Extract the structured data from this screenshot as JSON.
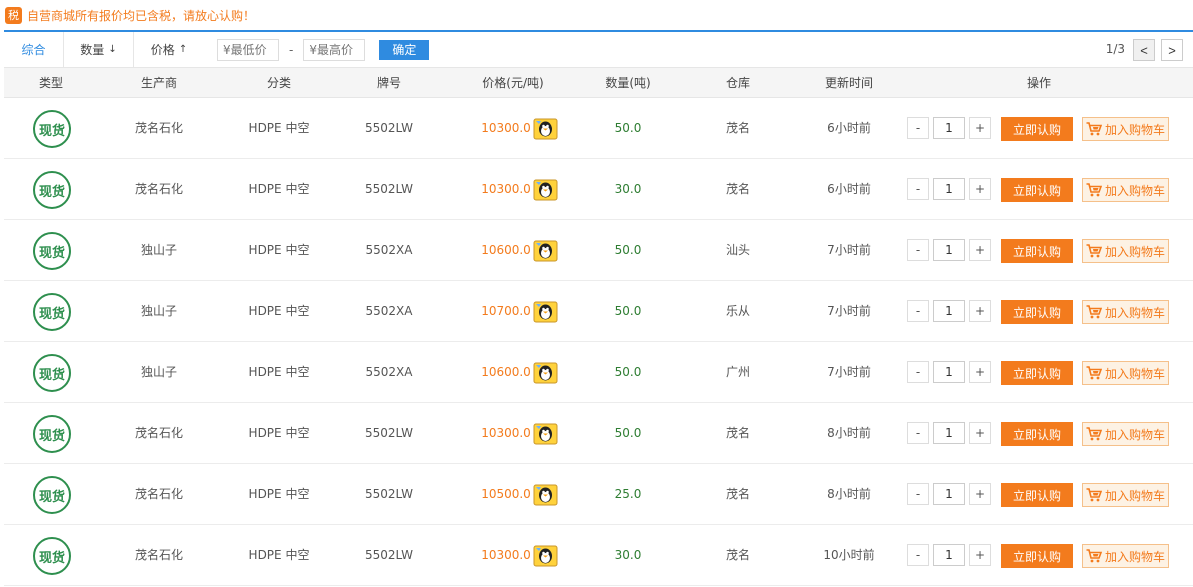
{
  "notice": {
    "badge": "税",
    "text": "自营商城所有报价均已含税，请放心认购！"
  },
  "toolbar": {
    "tabs": [
      {
        "label": "综合",
        "arrow": ""
      },
      {
        "label": "数量",
        "arrow": "↓"
      },
      {
        "label": "价格",
        "arrow": "↑"
      }
    ],
    "min_price_placeholder": "¥最低价",
    "max_price_placeholder": "¥最高价",
    "dash": "-",
    "confirm_label": "确定",
    "pager": "1/3",
    "prev": "<",
    "next": ">"
  },
  "table": {
    "headers": [
      "类型",
      "生产商",
      "分类",
      "牌号",
      "价格(元/吨)",
      "数量(吨)",
      "仓库",
      "更新时间",
      "操作"
    ],
    "stamp_text": "现货",
    "buy_label": "立即认购",
    "cart_label": "加入购物车",
    "minus": "-",
    "plus": "+",
    "rows": [
      {
        "maker": "茂名石化",
        "category": "HDPE 中空",
        "grade": "5502LW",
        "price": "10300.0",
        "qty": "50.0",
        "warehouse": "茂名",
        "updated": "6小时前",
        "count": "1"
      },
      {
        "maker": "茂名石化",
        "category": "HDPE 中空",
        "grade": "5502LW",
        "price": "10300.0",
        "qty": "30.0",
        "warehouse": "茂名",
        "updated": "6小时前",
        "count": "1"
      },
      {
        "maker": "独山子",
        "category": "HDPE 中空",
        "grade": "5502XA",
        "price": "10600.0",
        "qty": "50.0",
        "warehouse": "汕头",
        "updated": "7小时前",
        "count": "1"
      },
      {
        "maker": "独山子",
        "category": "HDPE 中空",
        "grade": "5502XA",
        "price": "10700.0",
        "qty": "50.0",
        "warehouse": "乐从",
        "updated": "7小时前",
        "count": "1"
      },
      {
        "maker": "独山子",
        "category": "HDPE 中空",
        "grade": "5502XA",
        "price": "10600.0",
        "qty": "50.0",
        "warehouse": "广州",
        "updated": "7小时前",
        "count": "1"
      },
      {
        "maker": "茂名石化",
        "category": "HDPE 中空",
        "grade": "5502LW",
        "price": "10300.0",
        "qty": "50.0",
        "warehouse": "茂名",
        "updated": "8小时前",
        "count": "1"
      },
      {
        "maker": "茂名石化",
        "category": "HDPE 中空",
        "grade": "5502LW",
        "price": "10500.0",
        "qty": "25.0",
        "warehouse": "茂名",
        "updated": "8小时前",
        "count": "1"
      },
      {
        "maker": "茂名石化",
        "category": "HDPE 中空",
        "grade": "5502LW",
        "price": "10300.0",
        "qty": "30.0",
        "warehouse": "茂名",
        "updated": "10小时前",
        "count": "1"
      }
    ]
  },
  "colors": {
    "accent": "#2f8be0",
    "orange": "#f37b1d",
    "green": "#2e8f4e"
  },
  "icons": {
    "qq": "qq-penguin-icon",
    "cart": "cart-icon"
  }
}
